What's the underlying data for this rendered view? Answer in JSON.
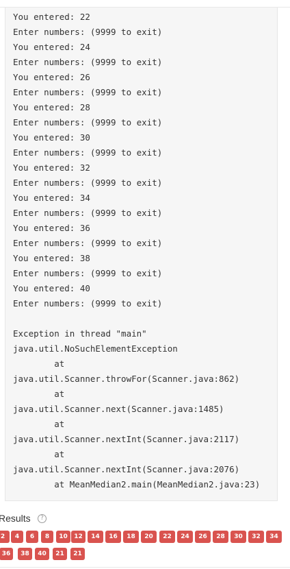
{
  "console": {
    "lines": [
      "You entered: 22",
      "Enter numbers: (9999 to exit)",
      "You entered: 24",
      "Enter numbers: (9999 to exit)",
      "You entered: 26",
      "Enter numbers: (9999 to exit)",
      "You entered: 28",
      "Enter numbers: (9999 to exit)",
      "You entered: 30",
      "Enter numbers: (9999 to exit)",
      "You entered: 32",
      "Enter numbers: (9999 to exit)",
      "You entered: 34",
      "Enter numbers: (9999 to exit)",
      "You entered: 36",
      "Enter numbers: (9999 to exit)",
      "You entered: 38",
      "Enter numbers: (9999 to exit)",
      "You entered: 40",
      "Enter numbers: (9999 to exit)",
      "",
      "Exception in thread \"main\"",
      "java.util.NoSuchElementException",
      "        at",
      "java.util.Scanner.throwFor(Scanner.java:862)",
      "        at",
      "java.util.Scanner.next(Scanner.java:1485)",
      "        at",
      "java.util.Scanner.nextInt(Scanner.java:2117)",
      "        at",
      "java.util.Scanner.nextInt(Scanner.java:2076)",
      "        at MeanMedian2.main(MeanMedian2.java:23)"
    ]
  },
  "results": {
    "label": "Results",
    "help_icon": "question-circle-icon",
    "help_glyph": "?",
    "badges": [
      "2",
      "4",
      "6",
      "8",
      "10",
      "12",
      "14",
      "16",
      "18",
      "20",
      "22",
      "24",
      "26",
      "28",
      "30",
      "32",
      "34",
      "36",
      "38",
      "40",
      "21",
      "21"
    ]
  },
  "colors": {
    "badge_background": "#d9534f",
    "console_background": "#f6f6f6",
    "text": "#333333"
  }
}
